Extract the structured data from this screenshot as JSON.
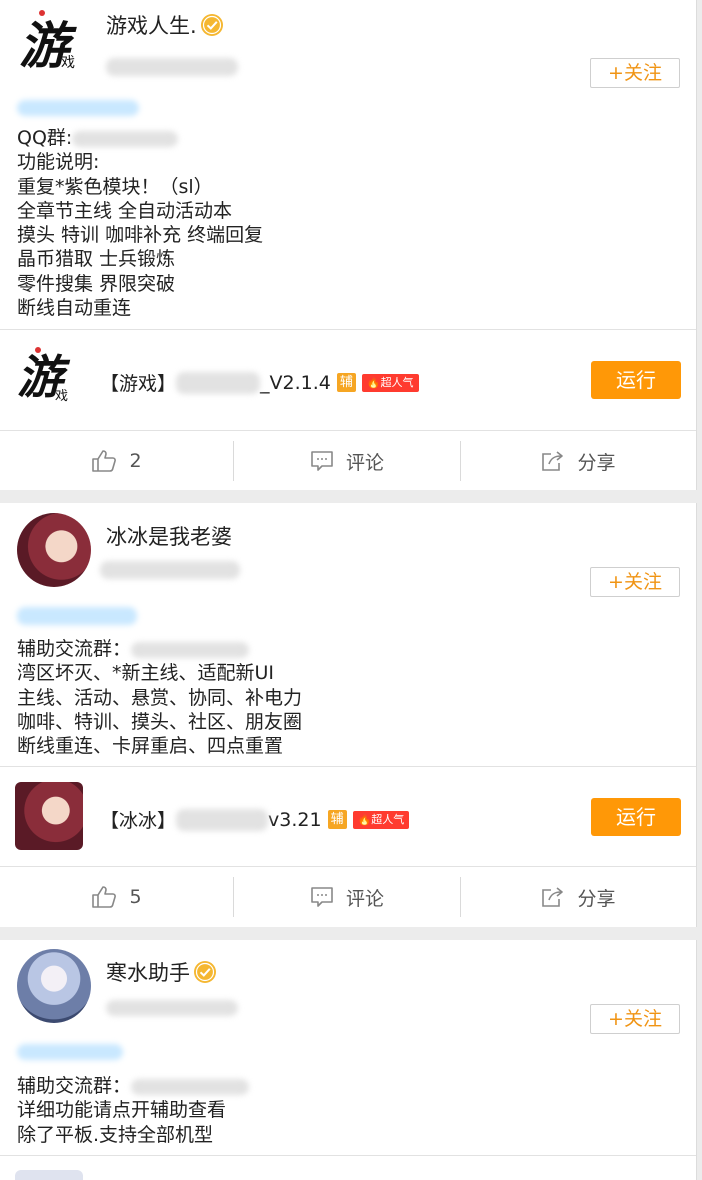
{
  "follow_label": "+关注",
  "run_label": "运行",
  "fu_badge": "辅",
  "hot_badge": "超人气",
  "posts": [
    {
      "author": "游戏人生.",
      "verified": true,
      "avatar_logo_main": "游",
      "avatar_logo_sub": "戏",
      "lines": [
        "QQ群:",
        "功能说明:",
        "重复*紫色模块！（sl）",
        "全章节主线 全自动活动本",
        "摸头 特训 咖啡补充 终端回复",
        "晶币猎取 士兵锻炼",
        "零件搜集 界限突破",
        "断线自动重连"
      ],
      "app_prefix": "【游戏】",
      "app_suffix": "_V2.1.4",
      "likes": "2",
      "comment_label": "评论",
      "share_label": "分享"
    },
    {
      "author": "冰冰是我老婆",
      "verified": false,
      "lines": [
        "辅助交流群：",
        "湾区坏灭、*新主线、适配新UI",
        "主线、活动、悬赏、协同、补电力",
        "咖啡、特训、摸头、社区、朋友圈",
        "断线重连、卡屏重启、四点重置"
      ],
      "app_prefix": "【冰冰】",
      "app_suffix": "v3.21",
      "likes": "5",
      "comment_label": "评论",
      "share_label": "分享"
    },
    {
      "author": "寒水助手",
      "verified": true,
      "lines": [
        "辅助交流群：",
        "详细功能请点开辅助查看",
        "除了平板.支持全部机型"
      ]
    }
  ],
  "colors": {
    "accent": "#f09414",
    "run_button": "#ff9807",
    "hot_badge": "#ff3b2f",
    "fu_badge": "#f6a623"
  }
}
